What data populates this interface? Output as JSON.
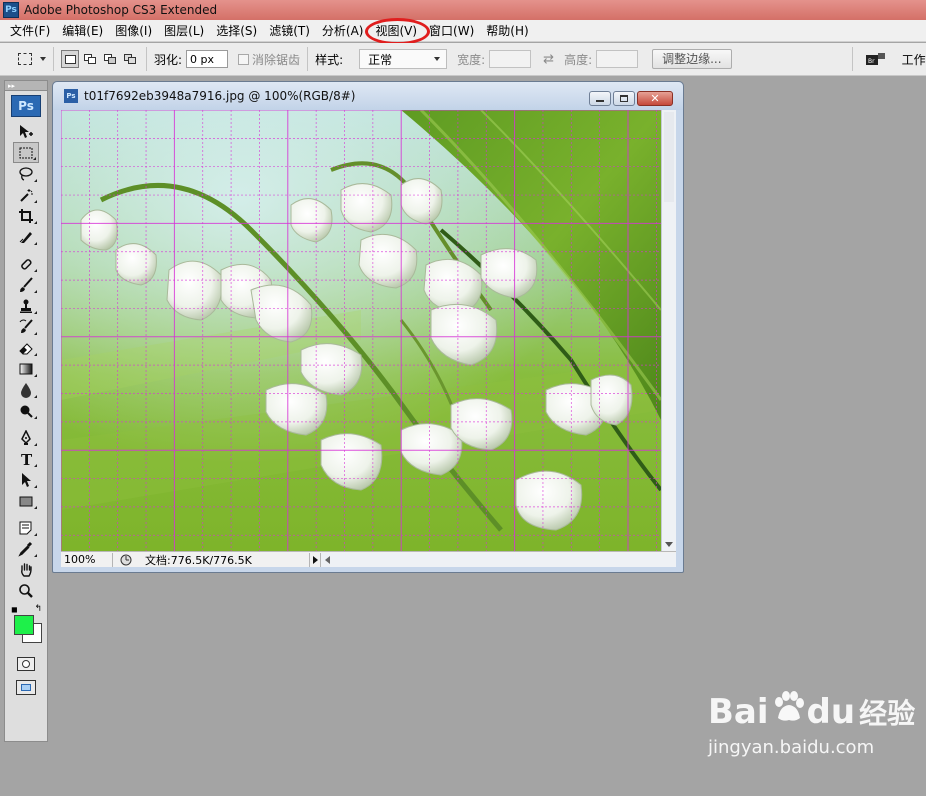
{
  "titlebar": {
    "title": "Adobe Photoshop CS3 Extended",
    "logo": "Ps"
  },
  "menu": {
    "items": [
      "文件(F)",
      "编辑(E)",
      "图像(I)",
      "图层(L)",
      "选择(S)",
      "滤镜(T)",
      "分析(A)",
      "视图(V)",
      "窗口(W)",
      "帮助(H)"
    ],
    "highlighted": "视图(V)"
  },
  "options": {
    "feather_label": "羽化:",
    "feather_value": "0 px",
    "antialias_label": "消除锯齿",
    "style_label": "样式:",
    "style_value": "正常",
    "width_label": "宽度:",
    "height_label": "高度:",
    "refine_edge": "调整边缘...",
    "workspace": "工作"
  },
  "tools": {
    "badge": "Ps",
    "foreground_color": "#1ef04a",
    "background_color": "#ffffff"
  },
  "document": {
    "title": "t01f7692eb3948a7916.jpg @ 100%(RGB/8#)",
    "icon": "Ps",
    "zoom": "100%",
    "doc_info": "文档:776.5K/776.5K",
    "grid_color": "#d733d7"
  },
  "watermark": {
    "brand_left": "Bai",
    "brand_right": "du",
    "brand_cn": "经验",
    "url": "jingyan.baidu.com"
  }
}
